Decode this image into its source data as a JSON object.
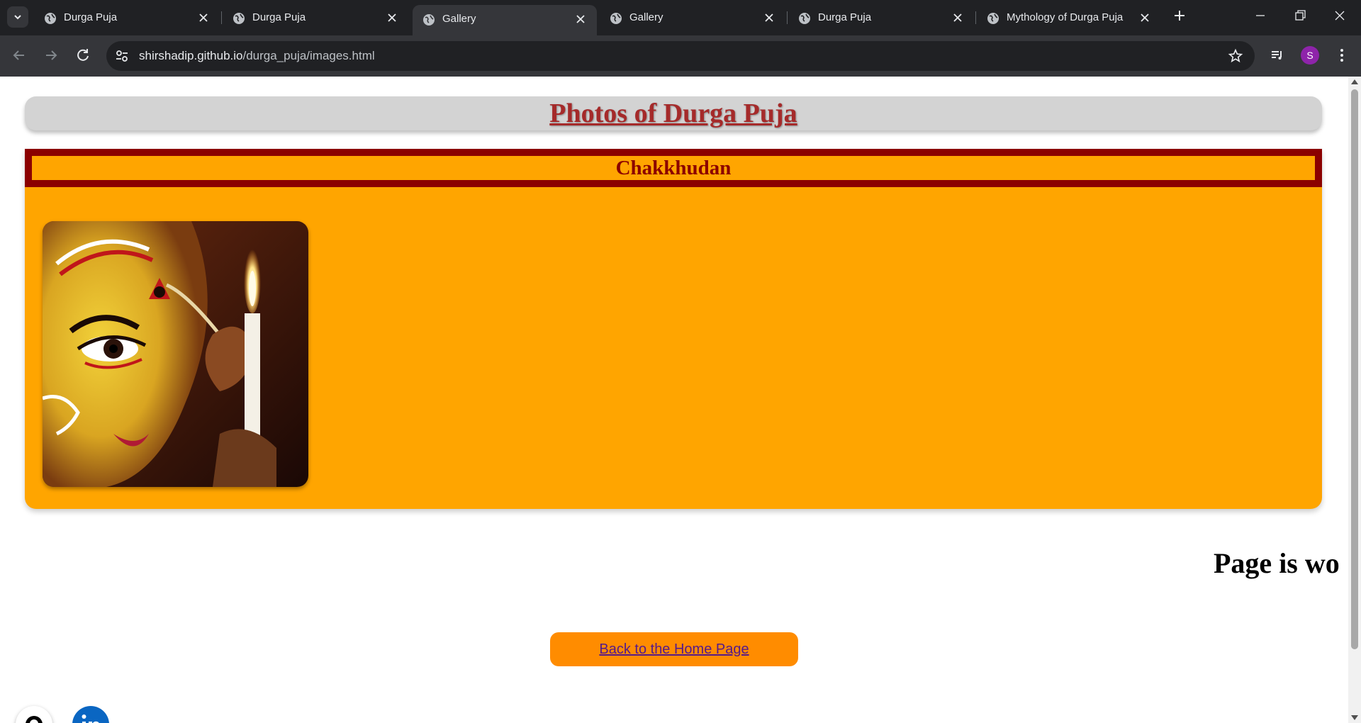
{
  "browser": {
    "tabs": [
      {
        "title": "Durga Puja",
        "active": false
      },
      {
        "title": "Durga Puja",
        "active": false
      },
      {
        "title": "Gallery",
        "active": true
      },
      {
        "title": "Gallery",
        "active": false
      },
      {
        "title": "Durga Puja",
        "active": false
      },
      {
        "title": "Mythology of Durga Puja",
        "active": false
      }
    ],
    "url_host": "shirshadip.github.io",
    "url_path": "/durga_puja/images.html",
    "profile_initial": "S",
    "profile_color": "#8e24aa"
  },
  "page": {
    "title": "Photos of Durga Puja",
    "section_title": "Chakkhudan",
    "photo_alt": "Chakkhudan",
    "work_in_progress": "Page is wo",
    "home_button": "Back to the Home Page",
    "social_icons": [
      "github-icon",
      "linkedin-icon"
    ],
    "colors": {
      "header_bg": "#d3d3d3",
      "title_color": "#a52a2a",
      "section_bg": "#ffa500",
      "section_border": "#8b0000",
      "button_bg": "#ff8c00"
    }
  }
}
